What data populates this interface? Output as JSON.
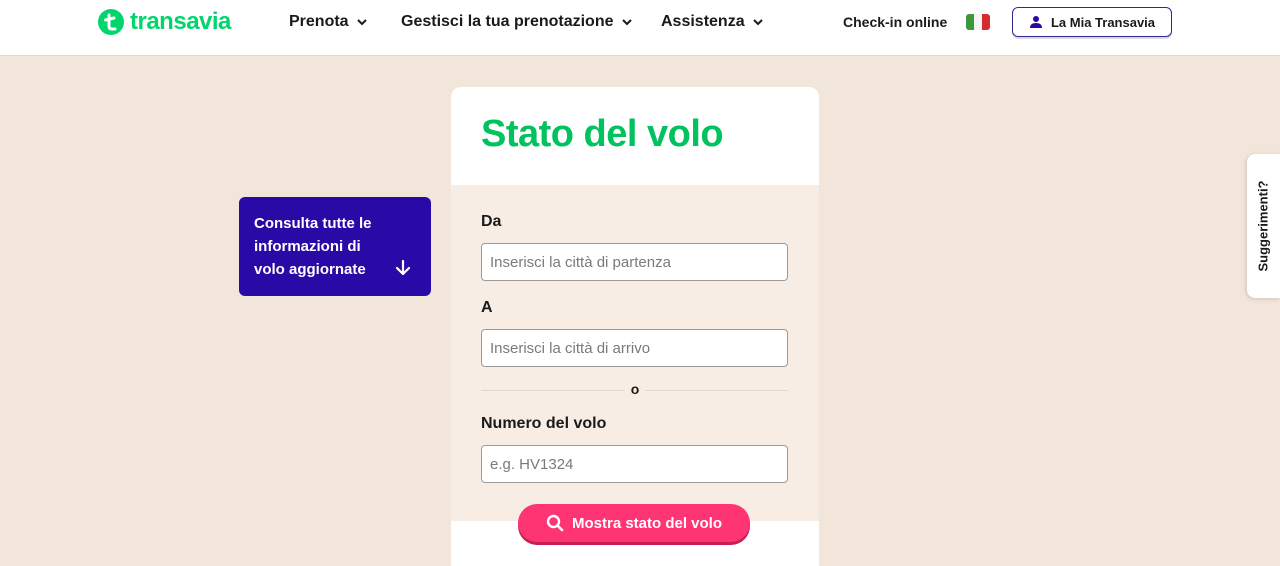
{
  "brand": {
    "name": "transavia",
    "color": "#00d66c"
  },
  "nav": {
    "items": [
      {
        "label": "Prenota"
      },
      {
        "label": "Gestisci la tua prenotazione"
      },
      {
        "label": "Assistenza"
      }
    ],
    "checkin_label": "Check-in online",
    "language_flag": "italy-flag-icon",
    "account_label": "La Mia Transavia"
  },
  "info_box": {
    "text": "Consulta tutte le informazioni di volo aggiornate",
    "icon": "arrow-down-icon",
    "color": "#2a0aa6"
  },
  "form": {
    "title": "Stato del volo",
    "from_label": "Da",
    "from_placeholder": "Inserisci la città di partenza",
    "to_label": "A",
    "to_placeholder": "Inserisci la città di arrivo",
    "or_text": "o",
    "flight_label": "Numero del volo",
    "flight_placeholder": "e.g. HV1324",
    "submit_label": "Mostra stato del volo",
    "submit_color": "#ff3473"
  },
  "feedback_tab": {
    "label": "Suggerimenti?"
  }
}
